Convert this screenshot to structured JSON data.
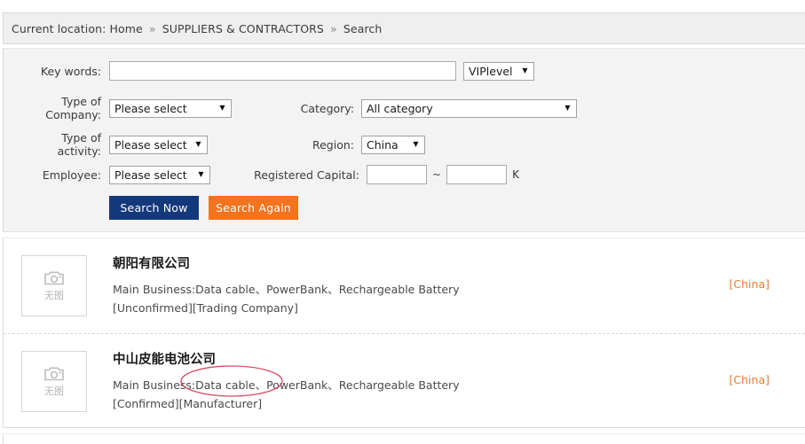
{
  "breadcrumb": {
    "prefix": "Current location:",
    "items": [
      "Home",
      "SUPPLIERS & CONTRACTORS",
      "Search"
    ],
    "separator": "»"
  },
  "search_form": {
    "keywords": {
      "label": "Key words:",
      "value": "",
      "placeholder": ""
    },
    "vip_level": {
      "value": "VIPlevel",
      "arrow": "▼"
    },
    "type_of_company": {
      "label_line1": "Type of",
      "label_line2": "Company:",
      "value": "Please select",
      "arrow": "▼"
    },
    "category": {
      "label": "Category:",
      "value": "All category",
      "arrow": "▼"
    },
    "type_of_activity": {
      "label_line1": "Type of",
      "label_line2": "activity:",
      "value": "Please select",
      "arrow": "▼"
    },
    "region": {
      "label": "Region:",
      "value": "China",
      "arrow": "▼"
    },
    "employee": {
      "label": "Employee:",
      "value": "Please select",
      "arrow": "▼"
    },
    "registered_capital": {
      "label": "Registered Capital:",
      "min_value": "",
      "max_value": "",
      "range_separator": "~",
      "unit": "K"
    },
    "buttons": {
      "search_now": "Search Now",
      "search_again": "Search Again"
    },
    "colors": {
      "search_now_bg": "#14387c",
      "search_again_bg": "#f4731d",
      "panel_bg": "#f3f3f3"
    }
  },
  "results": [
    {
      "thumb_caption": "无图",
      "thumb_icon": "camera-icon",
      "name": "朝阳有限公司",
      "main_business": "Main Business:Data cable、PowerBank、Rechargeable Battery",
      "tags": "[Unconfirmed][Trading Company]",
      "location": "[China]"
    },
    {
      "thumb_caption": "无图",
      "thumb_icon": "camera-icon",
      "name": "中山皮能电池公司",
      "main_business": "Main Business:Data cable、PowerBank、Rechargeable Battery",
      "tags": "[Confirmed][Manufacturer]",
      "location": "[China]"
    }
  ],
  "annotation": {
    "type": "red-ellipse-highlight",
    "target_text": "[Manufacturer]",
    "color": "#d94a5c"
  }
}
